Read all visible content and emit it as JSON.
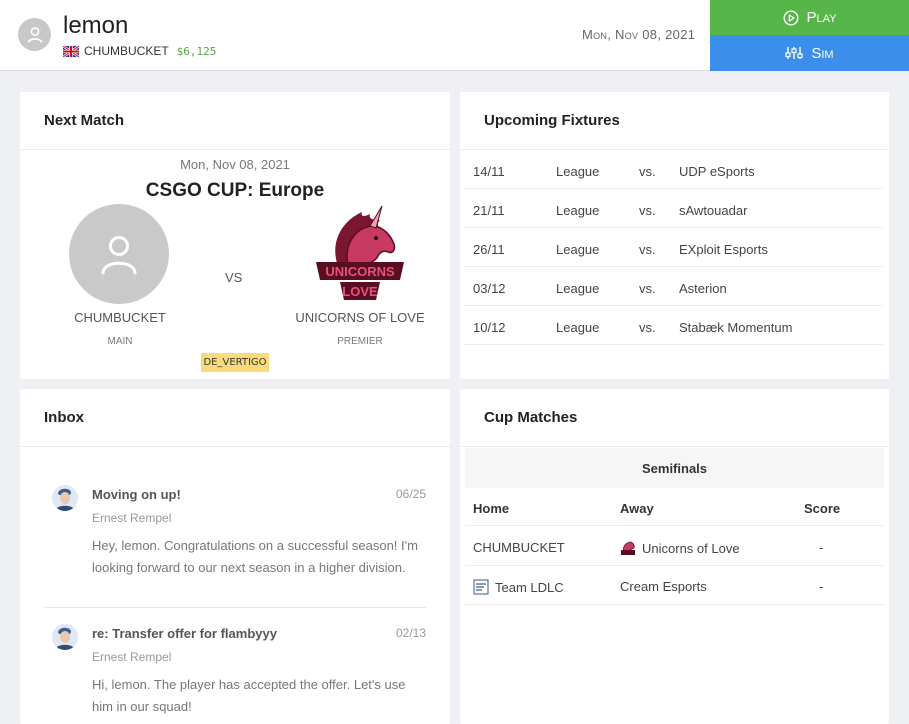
{
  "header": {
    "username": "lemon",
    "team": "CHUMBUCKET",
    "money": "$6,125",
    "date": "Mon, Nov 08, 2021",
    "play_label": "Play",
    "sim_label": "Sim"
  },
  "next_match": {
    "title": "Next Match",
    "date": "Mon, Nov 08, 2021",
    "competition": "CSGO CUP: Europe",
    "vs": "VS",
    "home": {
      "name": "CHUMBUCKET",
      "division": "MAIN"
    },
    "away": {
      "name": "UNICORNS OF LOVE",
      "division": "PREMIER",
      "logo_text": "UNICORNS OF LOVE"
    },
    "map": "DE_VERTIGO"
  },
  "fixtures": {
    "title": "Upcoming Fixtures",
    "vs": "vs.",
    "rows": [
      {
        "date": "14/11",
        "competition": "League",
        "opponent": "UDP eSports"
      },
      {
        "date": "21/11",
        "competition": "League",
        "opponent": "sAwtouadar"
      },
      {
        "date": "26/11",
        "competition": "League",
        "opponent": "EXploit Esports"
      },
      {
        "date": "03/12",
        "competition": "League",
        "opponent": "Asterion"
      },
      {
        "date": "10/12",
        "competition": "League",
        "opponent": "Stabæk Momentum"
      }
    ]
  },
  "inbox": {
    "title": "Inbox",
    "messages": [
      {
        "subject": "Moving on up!",
        "date": "06/25",
        "from": "Ernest Rempel",
        "body": "Hey, lemon. Congratulations on a successful season! I'm looking forward to our next season in a higher division."
      },
      {
        "subject": "re: Transfer offer for flambyyy",
        "date": "02/13",
        "from": "Ernest Rempel",
        "body": "Hi, lemon. The player has accepted the offer. Let's use him in our squad!"
      }
    ]
  },
  "cup": {
    "title": "Cup Matches",
    "round": "Semifinals",
    "headers": {
      "home": "Home",
      "away": "Away",
      "score": "Score"
    },
    "rows": [
      {
        "home": "CHUMBUCKET",
        "away": "Unicorns of Love",
        "score": "-"
      },
      {
        "home": "Team LDLC",
        "away": "Cream Esports",
        "score": "-"
      }
    ]
  },
  "colors": {
    "play": "#56b64a",
    "sim": "#3b8eea",
    "money": "#5aa447",
    "map_badge": "#f9db7e"
  }
}
